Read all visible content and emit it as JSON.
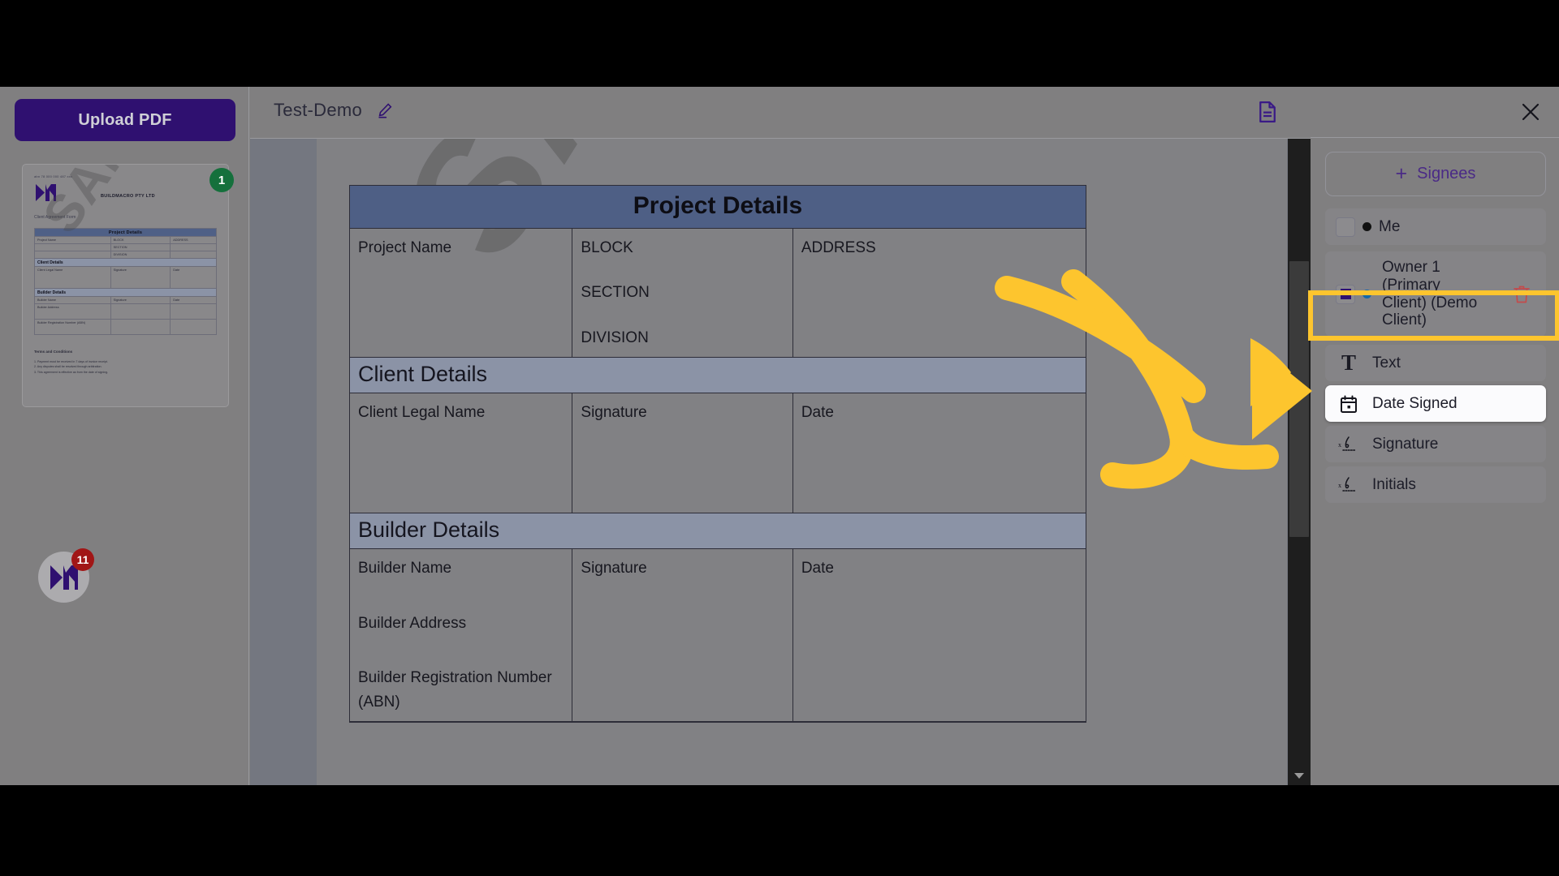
{
  "app": {
    "left_sidebar": {
      "upload_button": "Upload PDF",
      "thumbnail": {
        "page_badge": "1",
        "header_small": "abn 78 000 000 487 xxx",
        "company": "BUILDMACRO PTY LTD",
        "form_label": "Client Agreement Form",
        "watermark": "SAMPLE",
        "table": {
          "banner": "Project Details",
          "row1": [
            "Project Name",
            "BLOCK",
            "ADDRESS"
          ],
          "row1b": [
            "",
            "SECTION",
            ""
          ],
          "row1c": [
            "",
            "DIVISION",
            ""
          ],
          "sub1": "Client Details",
          "row2": [
            "Client Legal Name",
            "Signature",
            "Date"
          ],
          "sub2": "Builder Details",
          "row3": [
            "Builder Name",
            "Signature",
            "Date"
          ],
          "row3b": [
            "Builder Address",
            "",
            ""
          ],
          "row3c": [
            "Builder Registration Number (ABN)",
            "",
            ""
          ]
        },
        "terms_title": "Terms and Conditions",
        "terms": [
          "1.  Payment must be received in 7 days of invoice receipt.",
          "2.  Any disputes shall be resolved through arbitration.",
          "3.  This agreement is effective as from the date of signing."
        ]
      },
      "chat_widget": {
        "badge_count": "11",
        "name": "chat-widget"
      }
    },
    "topbar": {
      "document_title": "Test-Demo",
      "edit_icon": "pencil-icon",
      "document_icon": "document-page-icon"
    },
    "document": {
      "watermark": "SAMPLE",
      "sections": [
        {
          "banner": "Project Details",
          "rows": [
            {
              "cells": [
                "Project Name",
                "BLOCK\n\nSECTION\n\nDIVISION",
                "ADDRESS"
              ]
            }
          ]
        },
        {
          "banner": "Client Details",
          "rows": [
            {
              "cells": [
                "Client Legal Name",
                "Signature",
                "Date"
              ]
            }
          ]
        },
        {
          "banner": "Builder Details",
          "rows": [
            {
              "cells": [
                "Builder Name\n\nBuilder Address\n\nBuilder Registration Number\n(ABN)",
                "Signature",
                "Date"
              ]
            }
          ]
        }
      ],
      "cells": {
        "project_name": "Project Name",
        "block": "BLOCK",
        "section": "SECTION",
        "division": "DIVISION",
        "address": "ADDRESS",
        "client_legal_name": "Client Legal Name",
        "signature": "Signature",
        "date": "Date",
        "builder_name": "Builder Name",
        "builder_address": "Builder Address",
        "builder_reg": "Builder Registration Number",
        "builder_abn": "(ABN)"
      },
      "banners": {
        "project": "Project Details",
        "client": "Client Details",
        "builder": "Builder Details"
      }
    },
    "right_panel": {
      "close_label": "close-icon",
      "add_signees_label": "Signees",
      "add_signees_plus": "+",
      "me_label": "Me",
      "signee": {
        "name": "Owner 1 (Primary Client) (Demo Client)",
        "color_hex": "#2f1070",
        "dot_hex": "#1668a8",
        "delete_label": "trash-icon"
      },
      "fields": [
        {
          "label": "Text",
          "icon": "text-field-icon"
        },
        {
          "label": "Date Signed",
          "icon": "calendar-icon",
          "active": true
        },
        {
          "label": "Signature",
          "icon": "signature-icon"
        },
        {
          "label": "Initials",
          "icon": "initials-icon"
        }
      ]
    },
    "colors": {
      "brand_purple": "#2f1070",
      "accent_purple": "#4a2a86",
      "highlight_yellow": "#fdc52e",
      "badge_green": "#15703c",
      "badge_red": "#a11616",
      "table_header_blue": "#4e5f85",
      "table_subheader": "#8b93a6"
    },
    "annotation": {
      "arrow_color": "#fdc52e",
      "description": "curved-arrow-pointing-to-date-signed"
    }
  }
}
